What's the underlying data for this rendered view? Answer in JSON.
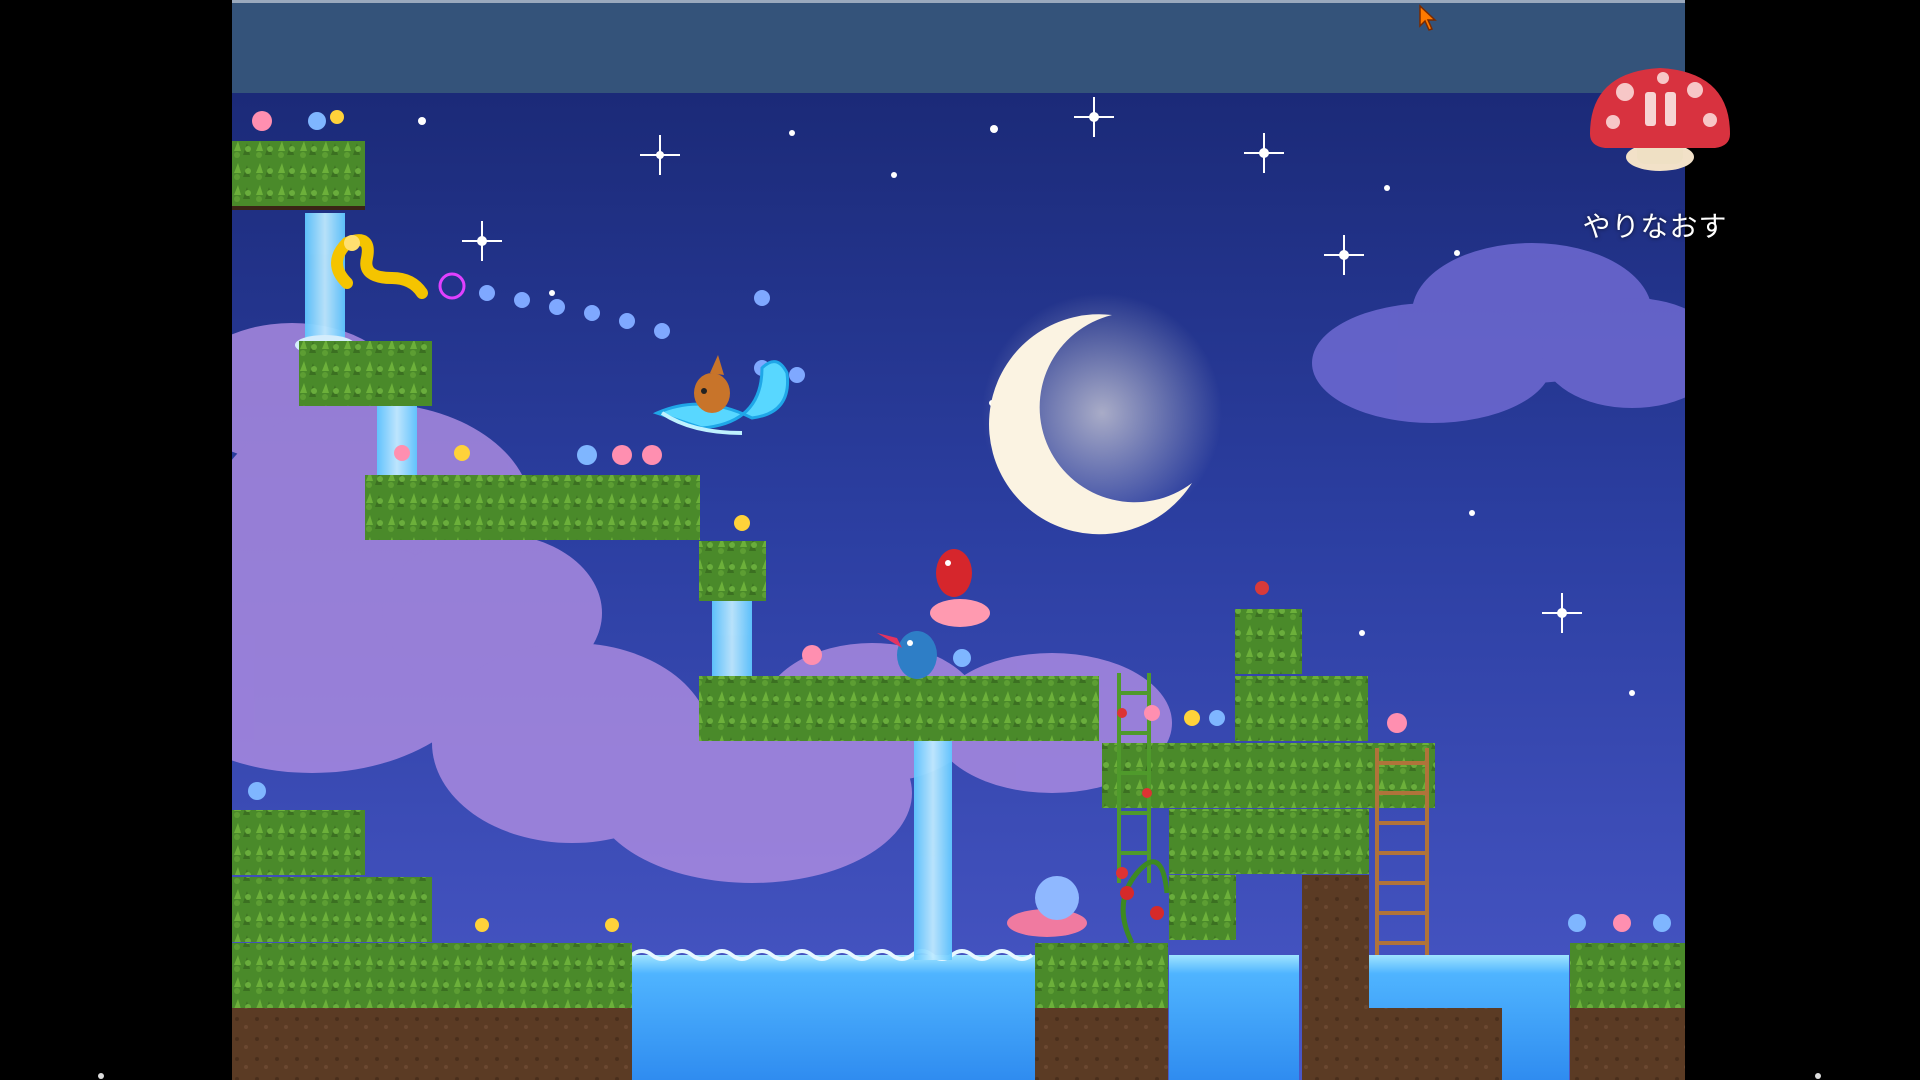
{
  "hud": {
    "pause_icon": "pause-icon",
    "retry_label": "やりなおす"
  },
  "icons": {
    "pause": "pause-icon",
    "cursor": "cursor-arrow-icon"
  },
  "colors": {
    "topbar": "#34537a",
    "sky_top": "#1a2c7a",
    "sky_mid": "#2e3fa0",
    "grass": "#4c8b2c",
    "dirt": "#5a3a22",
    "water": "#3aa0ff",
    "mushroom_cap": "#d8323f"
  },
  "scene": {
    "moon": "crescent-moon",
    "characters": [
      "blue-bird",
      "red-bird",
      "pink-crab",
      "orange-creature-on-leaf",
      "golden-snake"
    ]
  }
}
